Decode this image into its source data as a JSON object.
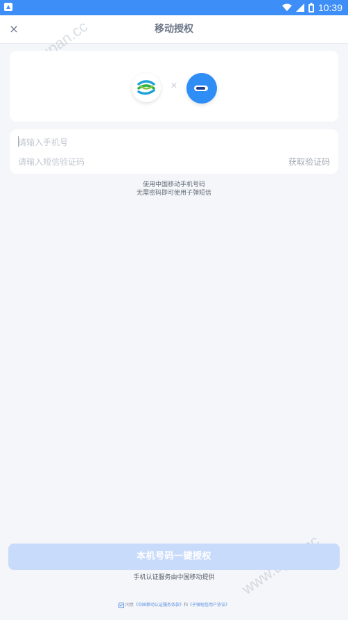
{
  "status_bar": {
    "time": "10:39",
    "icons": [
      "notification-icon",
      "wifi-icon",
      "signal-icon",
      "battery-icon"
    ]
  },
  "header": {
    "close_icon": "×",
    "title": "移动授权"
  },
  "logos": {
    "left": "china-mobile-logo",
    "separator": "×",
    "right": "bullet-sms-logo"
  },
  "form": {
    "phone_placeholder": "请输入手机号",
    "code_placeholder": "请输入短信验证码",
    "get_code_label": "获取验证码"
  },
  "hint": {
    "line1": "使用中国移动手机号码",
    "line2": "无需密码即可使用子弹短信"
  },
  "auth_button": {
    "label": "本机号码一键授权"
  },
  "provider_text": "手机认证服务由中国移动提供",
  "agreement": {
    "prefix": "同意",
    "link1": "《中国移动认证服务条款》",
    "conjunction": "和",
    "link2": "《子弹短信用户协议》"
  },
  "watermark": "www.upan.cc",
  "colors": {
    "status_bar": "#3e8ef7",
    "button_disabled": "#c9dbfb",
    "link": "#5b8fe0"
  }
}
